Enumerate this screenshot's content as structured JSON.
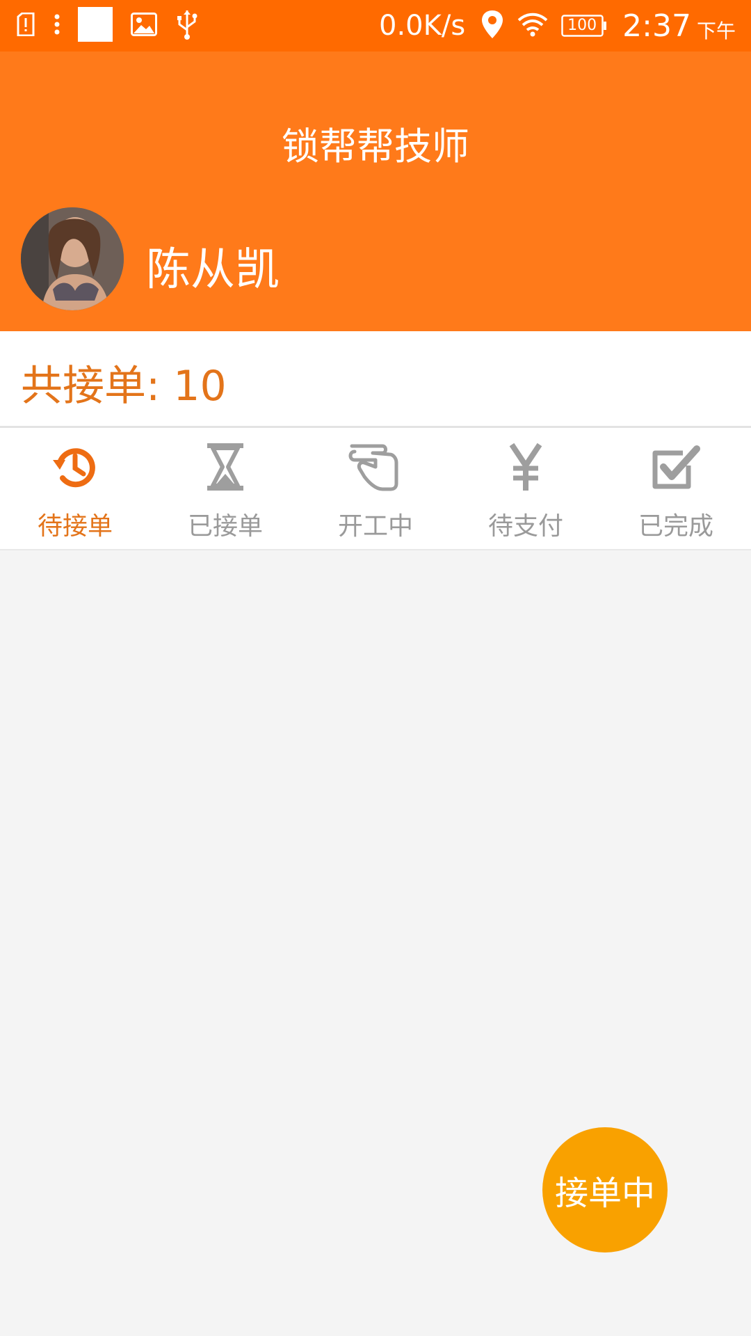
{
  "status_bar": {
    "net_speed": "0.0K/s",
    "battery": "100",
    "time": "2:37",
    "ampm": "下午",
    "icons": [
      "alert-sim-icon",
      "more-dots-icon",
      "white-square-icon",
      "image-icon",
      "usb-icon",
      "location-icon",
      "wifi-icon",
      "battery-icon"
    ]
  },
  "header": {
    "title": "锁帮帮技师",
    "user_name": "陈从凯"
  },
  "summary": {
    "total_orders_text": "共接单: 10"
  },
  "tabs": [
    {
      "label": "待接单",
      "icon": "history-clock-icon",
      "active": true
    },
    {
      "label": "已接单",
      "icon": "hourglass-icon",
      "active": false
    },
    {
      "label": "开工中",
      "icon": "pointing-hand-icon",
      "active": false
    },
    {
      "label": "待支付",
      "icon": "yen-icon",
      "active": false
    },
    {
      "label": "已完成",
      "icon": "checkbox-checked-icon",
      "active": false
    }
  ],
  "fab": {
    "label": "接单中"
  },
  "colors": {
    "status_bar": "#ff6a00",
    "header": "#ff7a1a",
    "accent_text": "#e3741a",
    "inactive": "#9a9a9a",
    "fab": "#f9a100",
    "background": "#f4f4f4"
  }
}
